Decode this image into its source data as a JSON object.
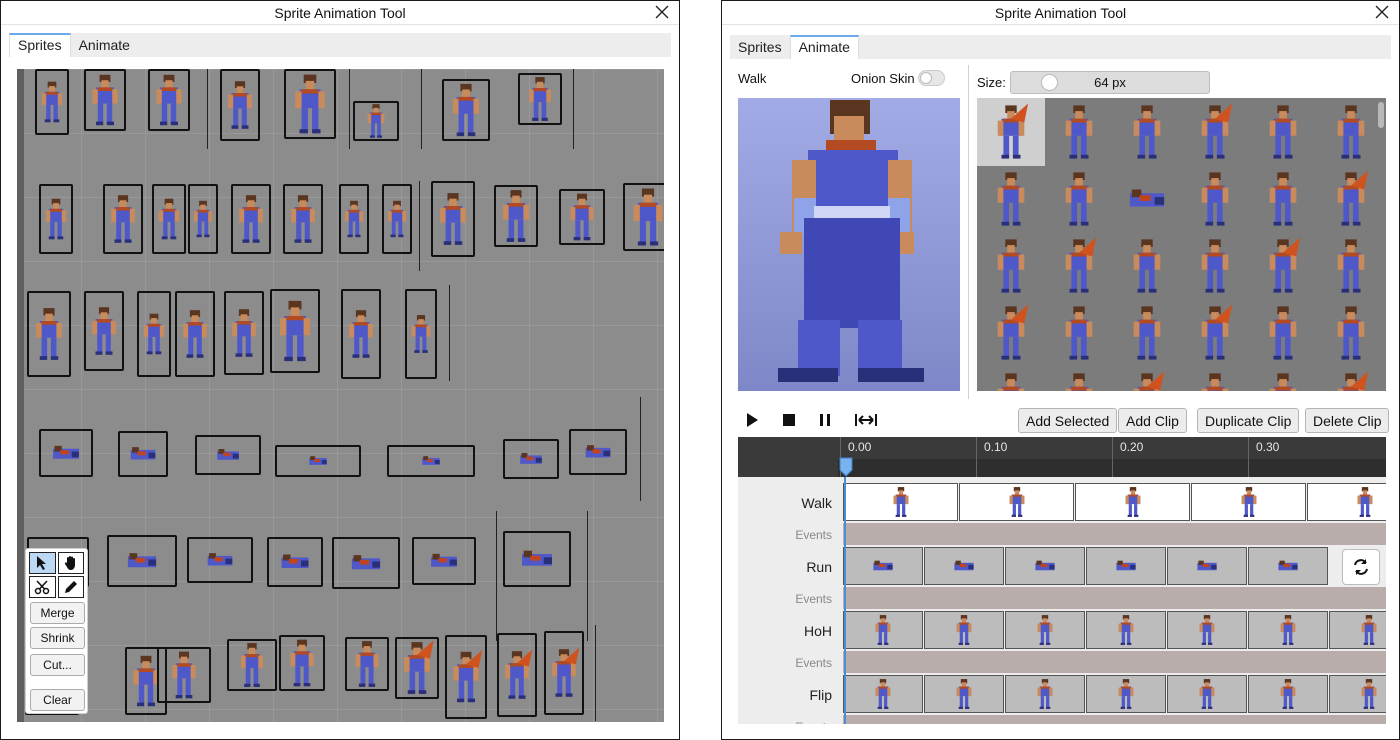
{
  "left_window": {
    "title": "Sprite Animation Tool",
    "tabs": [
      {
        "label": "Sprites",
        "active": true
      },
      {
        "label": "Animate",
        "active": false
      }
    ],
    "toolbox": {
      "tools": [
        "select-tool",
        "pan-tool",
        "cut-tool",
        "draw-tool"
      ],
      "buttons": [
        "Merge",
        "Shrink",
        "Cut...",
        "Clear"
      ]
    }
  },
  "right_window": {
    "title": "Sprite Animation Tool",
    "tabs": [
      {
        "label": "Sprites",
        "active": false
      },
      {
        "label": "Animate",
        "active": true
      }
    ],
    "clip_name": "Walk",
    "onion_skin_label": "Onion Skin",
    "onion_skin_on": false,
    "size_label": "Size:",
    "size_value": "64 px",
    "actions": [
      "Add Selected",
      "Add Clip",
      "Duplicate Clip",
      "Delete Clip"
    ],
    "playback": [
      "play-icon",
      "stop-icon",
      "pause-icon",
      "fit-width-icon"
    ],
    "timeline": {
      "ticks": [
        "0.00",
        "0.10",
        "0.20",
        "0.30"
      ],
      "tracks": [
        {
          "name": "Walk",
          "events_label": "Events"
        },
        {
          "name": "Run",
          "events_label": "Events"
        },
        {
          "name": "HoH",
          "events_label": "Events"
        },
        {
          "name": "Flip",
          "events_label": "Events"
        }
      ]
    }
  },
  "colors": {
    "sheet_bg": "#8c8c8c",
    "sprite_blue": "#4f58c8",
    "sprite_red": "#c0451f",
    "accent": "#4a8fd6"
  }
}
